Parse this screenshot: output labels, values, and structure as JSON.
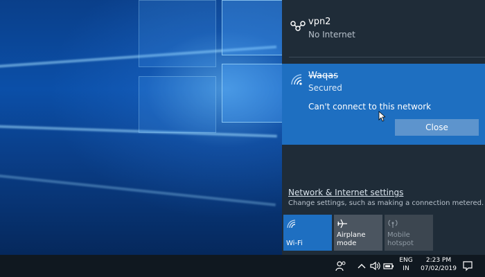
{
  "flyout": {
    "vpn": {
      "name": "vpn2",
      "status": "No Internet",
      "icon": "vpn-icon"
    },
    "wifi": {
      "name": "Waqas",
      "status": "Secured",
      "error": "Can't connect to this network",
      "close_label": "Close",
      "icon": "wifi-icon"
    },
    "settings_link": "Network & Internet settings",
    "settings_desc": "Change settings, such as making a connection metered.",
    "quick_actions": [
      {
        "label": "Wi-Fi",
        "icon": "wifi-icon",
        "active": true
      },
      {
        "label": "Airplane mode",
        "icon": "airplane-icon",
        "active": false
      },
      {
        "label_line1": "Mobile",
        "label_line2": "hotspot",
        "icon": "hotspot-icon",
        "active": false
      }
    ]
  },
  "taskbar": {
    "lang_line1": "ENG",
    "lang_line2": "IN",
    "time": "2:23 PM",
    "date": "07/02/2019",
    "icons": [
      "people-icon",
      "chevron-up-icon",
      "speaker-icon",
      "battery-icon",
      "action-center-icon"
    ]
  },
  "colors": {
    "accent": "#1e6fc1",
    "flyout_bg": "#1f2c38",
    "taskbar_bg": "#101820"
  }
}
